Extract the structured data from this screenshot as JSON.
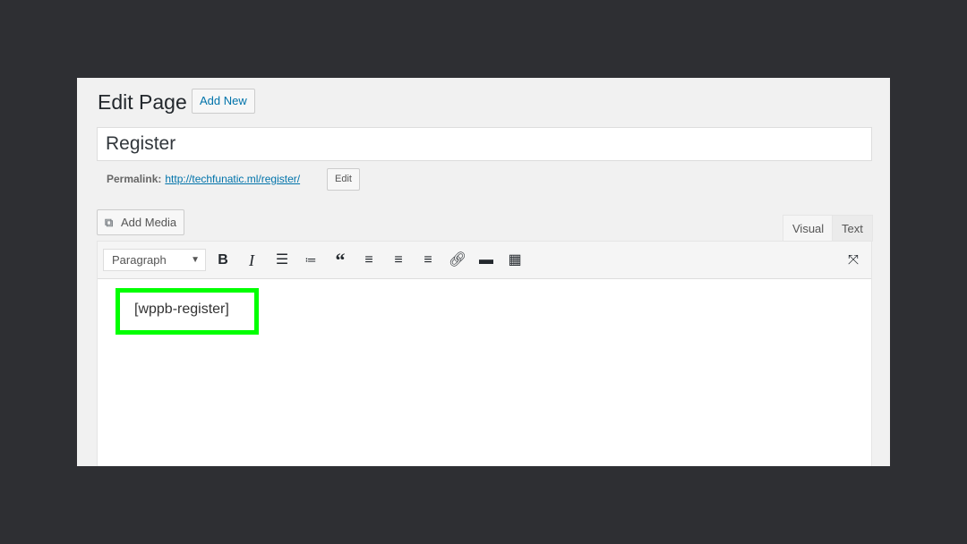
{
  "header": {
    "title": "Edit Page",
    "add_new": "Add New"
  },
  "post": {
    "title": "Register"
  },
  "permalink": {
    "label": "Permalink:",
    "url": "http://techfunatic.ml/register/",
    "edit": "Edit"
  },
  "editor": {
    "add_media": "Add Media",
    "tabs": [
      {
        "label": "Visual",
        "active": true
      },
      {
        "label": "Text",
        "active": false
      }
    ],
    "format_select": "Paragraph",
    "toolbar_icons": [
      "bold-icon",
      "italic-icon",
      "bullet-list-icon",
      "numbered-list-icon",
      "blockquote-icon",
      "align-left-icon",
      "align-center-icon",
      "align-right-icon",
      "link-icon",
      "read-more-icon",
      "toolbar-toggle-icon",
      "fullscreen-icon"
    ],
    "content": "[wppb-register]",
    "highlight_color": "#00ff00"
  }
}
